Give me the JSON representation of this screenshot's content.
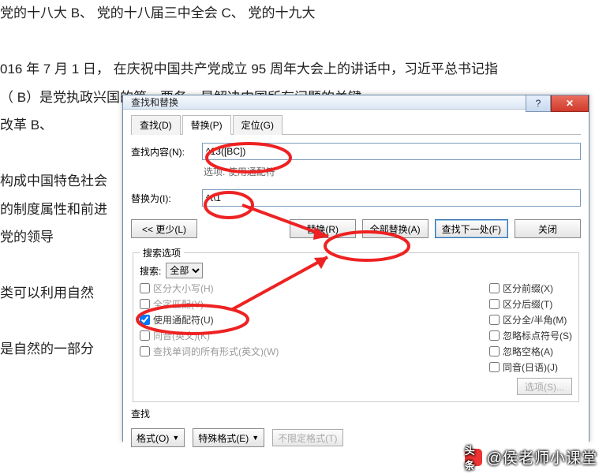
{
  "document_lines": [
    "党的十八大        B、 党的十八届三中全会        C、 党的十九大",
    "",
    "016 年 7 月 1 日， 在庆祝中国共产党成立 95 周年大会上的讲话中，习近平总书记指",
    "（ B）是党执政兴国的第一要务，是解决中国所有问题的关键。",
    "改革                B、",
    "",
    "构成中国特色社会",
    "的制度属性和前进",
    "党的领导",
    "",
    "类可以利用自然",
    "",
    "是自然的一部分"
  ],
  "dialog": {
    "title": "查找和替换",
    "tabs": {
      "find": "查找(D)",
      "replace": "替换(P)",
      "goto": "定位(G)"
    },
    "active_tab": "replace",
    "find_label": "查找内容(N):",
    "find_value": "^13([BC])",
    "options_label": "选项:",
    "options_value": "使用通配符",
    "replace_label": "替换为(I):",
    "replace_value": "^t\\1",
    "btn_less": "<< 更少(L)",
    "btn_replace": "替换(R)",
    "btn_replace_all": "全部替换(A)",
    "btn_find_next": "查找下一处(F)",
    "btn_close": "关闭",
    "opts_legend": "搜索选项",
    "search_label": "搜索:",
    "search_scope": "全部",
    "left_checks": [
      {
        "label": "区分大小写(H)",
        "checked": false,
        "disabled": true
      },
      {
        "label": "全字匹配(Y)",
        "checked": false,
        "disabled": true
      },
      {
        "label": "使用通配符(U)",
        "checked": true,
        "disabled": false
      },
      {
        "label": "同音(英文)(K)",
        "checked": false,
        "disabled": true
      },
      {
        "label": "查找单词的所有形式(英文)(W)",
        "checked": false,
        "disabled": true
      }
    ],
    "right_checks": [
      {
        "label": "区分前缀(X)",
        "checked": false
      },
      {
        "label": "区分后缀(T)",
        "checked": false
      },
      {
        "label": "区分全/半角(M)",
        "checked": false
      },
      {
        "label": "忽略标点符号(S)",
        "checked": false
      },
      {
        "label": "忽略空格(A)",
        "checked": false
      },
      {
        "label": "同音(日语)(J)",
        "checked": false
      }
    ],
    "btn_options_s": "选项(S)...",
    "find_section": "查找",
    "btn_format": "格式(O)",
    "btn_special": "特殊格式(E)",
    "btn_noformat": "不限定格式(T)"
  },
  "watermark": {
    "logo_text": "头条",
    "text": "@侯老师小课堂"
  }
}
